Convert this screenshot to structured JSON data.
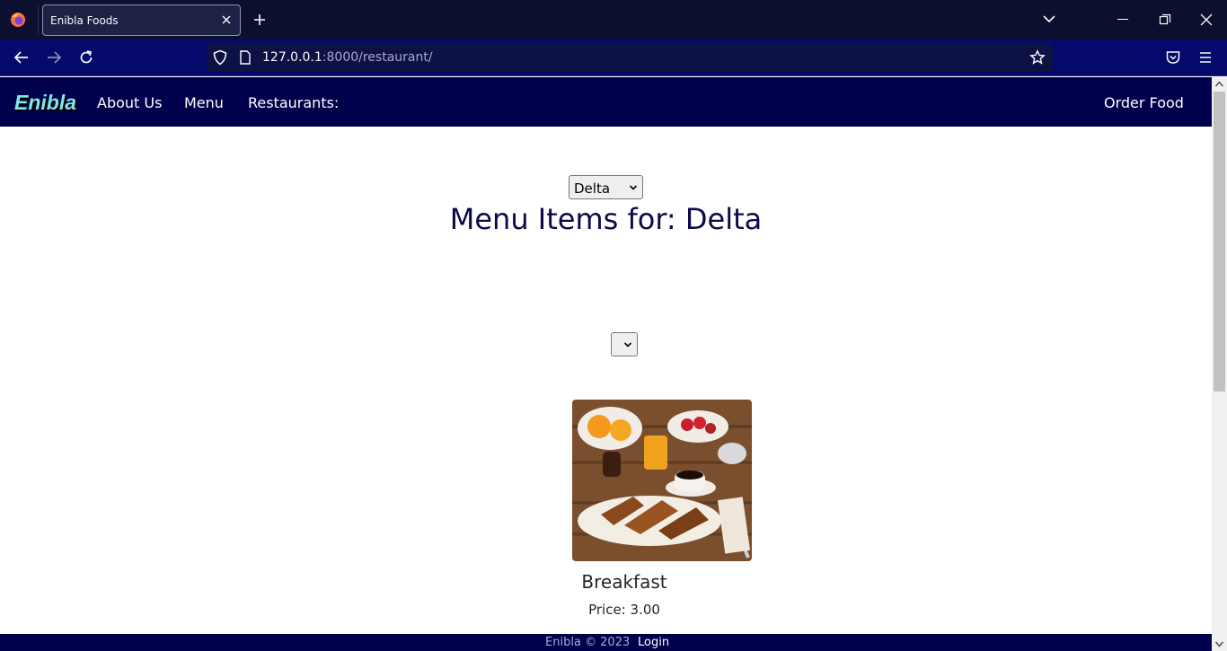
{
  "browser": {
    "tab_title": "Enibla Foods",
    "url_host": "127.0.0.1",
    "url_path": ":8000/restaurant/"
  },
  "site": {
    "brand": "Enibla",
    "nav": {
      "about": "About Us",
      "menu": "Menu",
      "restaurants": "Restaurants:",
      "order": "Order Food"
    }
  },
  "main": {
    "restaurant_select": "Delta",
    "heading": "Menu Items for: Delta",
    "category_select": "",
    "items": [
      {
        "name": "Breakfast",
        "price": "Price: 3.00"
      }
    ]
  },
  "footer": {
    "copyright": "Enibla © 2023",
    "login": "Login"
  },
  "colors": {
    "navbar": "#00004d",
    "brand": "#7fe7e8",
    "browser_toolbar": "#05096b"
  }
}
